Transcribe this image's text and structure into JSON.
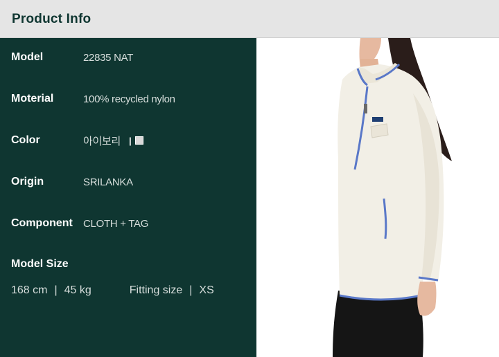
{
  "header": {
    "title": "Product Info"
  },
  "specs": [
    {
      "key": "Model",
      "value": "22835 NAT"
    },
    {
      "key": "Moterial",
      "value": "100% recycled nylon"
    },
    {
      "key": "Color",
      "value": "아이보리",
      "swatch_separator": "|",
      "swatch_color": "#d9d9d9"
    },
    {
      "key": "Origin",
      "value": "SRILANKA"
    },
    {
      "key": "Component",
      "value": "CLOTH + TAG"
    }
  ],
  "model_size": {
    "label": "Model Size",
    "height": "168 cm",
    "separator": "|",
    "weight": "45 kg",
    "fitting_label": "Fitting size",
    "fitting_separator": "|",
    "fitting_value": "XS"
  },
  "colors": {
    "panel_bg": "#0f3631",
    "header_bg": "#e5e5e5",
    "fleece": "#f2efe6",
    "trim_blue": "#5a78c8",
    "pants": "#151515"
  }
}
